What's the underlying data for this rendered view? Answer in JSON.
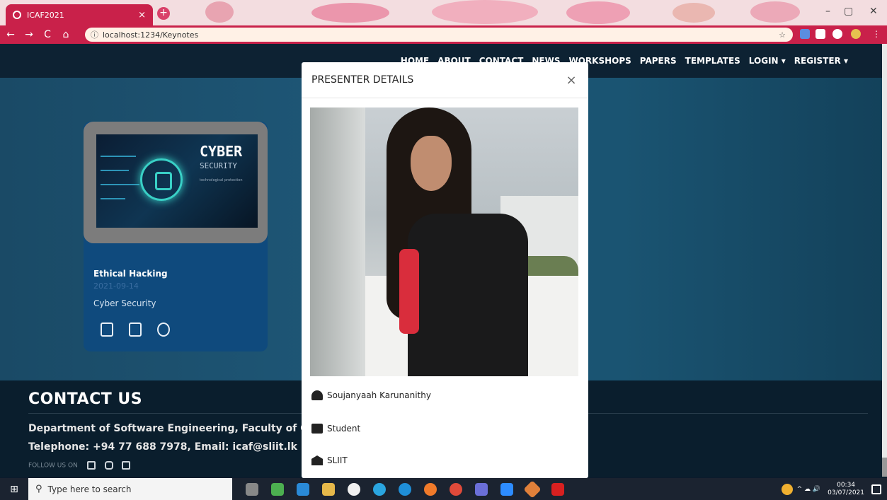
{
  "browser": {
    "tab_title": "ICAF2021",
    "tab_close": "×",
    "new_tab": "+",
    "url": "localhost:1234/Keynotes",
    "url_info_icon": "ⓘ",
    "star_icon": "☆",
    "nav_icons": [
      "←",
      "→",
      "C",
      "⌂"
    ],
    "window_controls": [
      "–",
      "▢",
      "✕"
    ]
  },
  "topnav": {
    "items": [
      "HOME",
      "ABOUT",
      "CONTACT",
      "NEWS",
      "WORKSHOPS",
      "PAPERS",
      "TEMPLATES",
      "LOGIN ▾",
      "REGISTER ▾"
    ]
  },
  "card": {
    "image_title": "CYBER",
    "image_subtitle": "SECURITY",
    "image_caption": "technological protection",
    "title": "Ethical Hacking",
    "date": "2021-09-14",
    "category": "Cyber Security"
  },
  "footer": {
    "heading": "CONTACT US",
    "line1": "Department of Software Engineering, Faculty of Com",
    "line2": "Telephone: +94 77 688 7978, Email: icaf@sliit.lk",
    "follow": "FOLLOW US ON"
  },
  "modal": {
    "title": "PRESENTER DETAILS",
    "close": "×",
    "name": "Soujanyaah Karunanithy",
    "role": "Student",
    "institution": "SLIIT"
  },
  "taskbar": {
    "start_icon": "⊞",
    "search_placeholder": "Type here to search",
    "search_icon": "⚲",
    "time": "00:34",
    "date": "03/07/2021",
    "tray_symbols": "^ ☁ 🔊"
  }
}
